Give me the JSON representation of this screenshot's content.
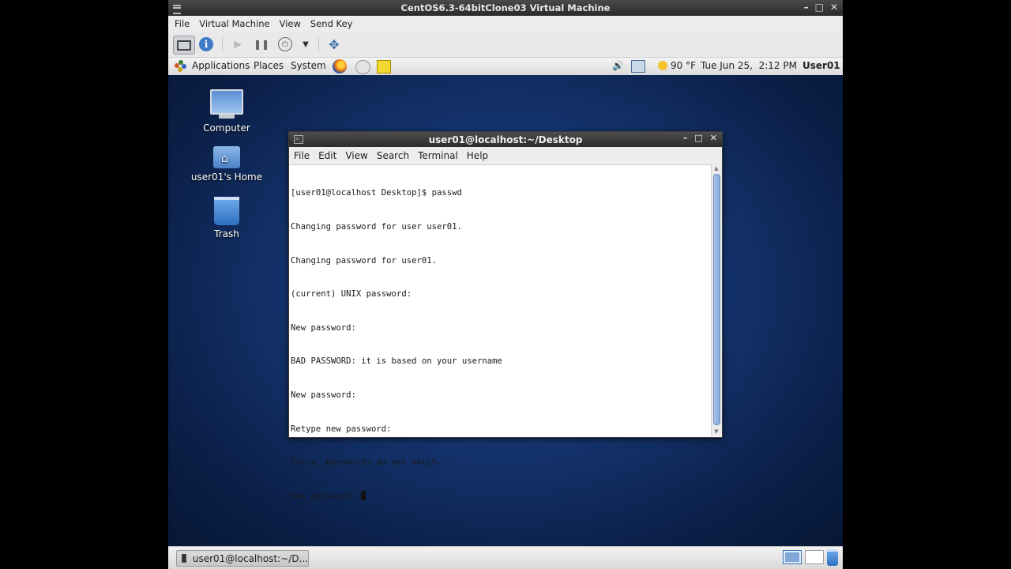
{
  "vm": {
    "title": "CentOS6.3-64bitClone03 Virtual Machine",
    "window_buttons": [
      "–",
      "□",
      "✕"
    ],
    "menu": [
      "File",
      "Virtual Machine",
      "View",
      "Send Key"
    ]
  },
  "gnome_panel": {
    "menu": [
      "Applications",
      "Places",
      "System"
    ],
    "weather": "90 °F",
    "datetime": "Tue Jun 25,  2:12 PM",
    "user": "User01"
  },
  "desktop_icons": [
    {
      "label": "Computer",
      "icon": "computer-icon"
    },
    {
      "label": "user01's Home",
      "icon": "home-folder-icon"
    },
    {
      "label": "Trash",
      "icon": "trash-icon"
    }
  ],
  "terminal": {
    "title": "user01@localhost:~/Desktop",
    "window_buttons": [
      "–",
      "□",
      "✕"
    ],
    "menu": [
      "File",
      "Edit",
      "View",
      "Search",
      "Terminal",
      "Help"
    ],
    "lines": [
      "[user01@localhost Desktop]$ passwd",
      "Changing password for user user01.",
      "Changing password for user01.",
      "(current) UNIX password:",
      "New password:",
      "BAD PASSWORD: it is based on your username",
      "New password:",
      "Retype new password:",
      "Sorry, passwords do not match.",
      "New password: "
    ]
  },
  "taskbar": {
    "task_label": "user01@localhost:~/D..."
  }
}
